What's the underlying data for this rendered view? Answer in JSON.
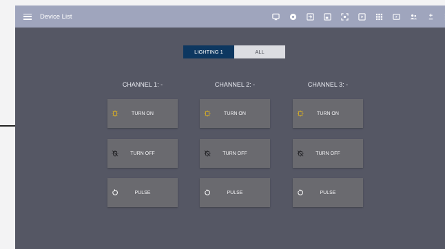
{
  "header": {
    "title": "Device List"
  },
  "colors": {
    "header_bg": "#9fa5bd",
    "app_bg": "#555764",
    "tab_active_bg": "#0d3760",
    "tab_inactive_bg": "#dcdde2",
    "button_bg": "#6a6a6f",
    "bulb_on": "#e3b51f"
  },
  "toolbar": {
    "icons": [
      "monitor-icon",
      "target-icon",
      "login-icon",
      "window-icon",
      "focus-icon",
      "play-square-icon",
      "grid-icon",
      "video-icon",
      "people-icon",
      "plus-minus-icon",
      "grid-small-icon"
    ]
  },
  "tabs": [
    {
      "label": "LIGHTING 1",
      "active": true
    },
    {
      "label": "ALL",
      "active": false
    }
  ],
  "channels": [
    {
      "title": "CHANNEL 1: -",
      "buttons": [
        {
          "label": "TURN ON",
          "icon": "bulb-on-icon"
        },
        {
          "label": "TURN OFF",
          "icon": "bulb-off-icon"
        },
        {
          "label": "PULSE",
          "icon": "refresh-icon"
        }
      ]
    },
    {
      "title": "CHANNEL 2: -",
      "buttons": [
        {
          "label": "TURN ON",
          "icon": "bulb-on-icon"
        },
        {
          "label": "TURN OFF",
          "icon": "bulb-off-icon"
        },
        {
          "label": "PULSE",
          "icon": "refresh-icon"
        }
      ]
    },
    {
      "title": "CHANNEL 3: -",
      "buttons": [
        {
          "label": "TURN ON",
          "icon": "bulb-on-icon"
        },
        {
          "label": "TURN OFF",
          "icon": "bulb-off-icon"
        },
        {
          "label": "PULSE",
          "icon": "refresh-icon"
        }
      ]
    }
  ]
}
